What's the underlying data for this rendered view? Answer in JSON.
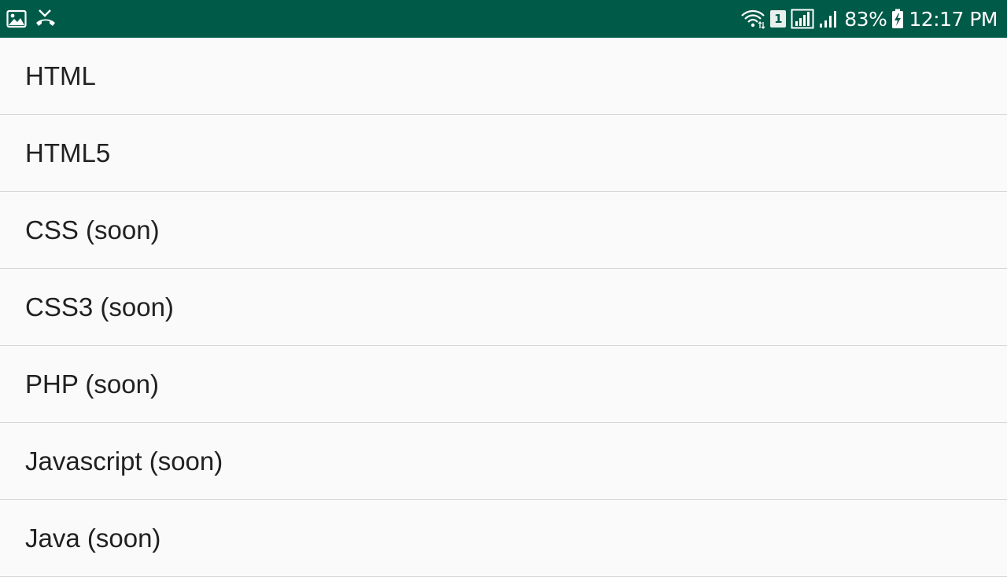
{
  "status_bar": {
    "left_icons": [
      "gallery-icon",
      "missed-call-icon"
    ],
    "right_icons": [
      "wifi-icon",
      "sim-badge",
      "signal-icon",
      "signal-weak-icon",
      "battery-charging-icon"
    ],
    "sim_number": "1",
    "battery": "83%",
    "time": "12:17 PM",
    "background_color": "#005a48"
  },
  "list": {
    "items": [
      {
        "label": "HTML"
      },
      {
        "label": "HTML5"
      },
      {
        "label": "CSS (soon)"
      },
      {
        "label": "CSS3 (soon)"
      },
      {
        "label": "PHP (soon)"
      },
      {
        "label": "Javascript (soon)"
      },
      {
        "label": "Java (soon)"
      }
    ]
  }
}
